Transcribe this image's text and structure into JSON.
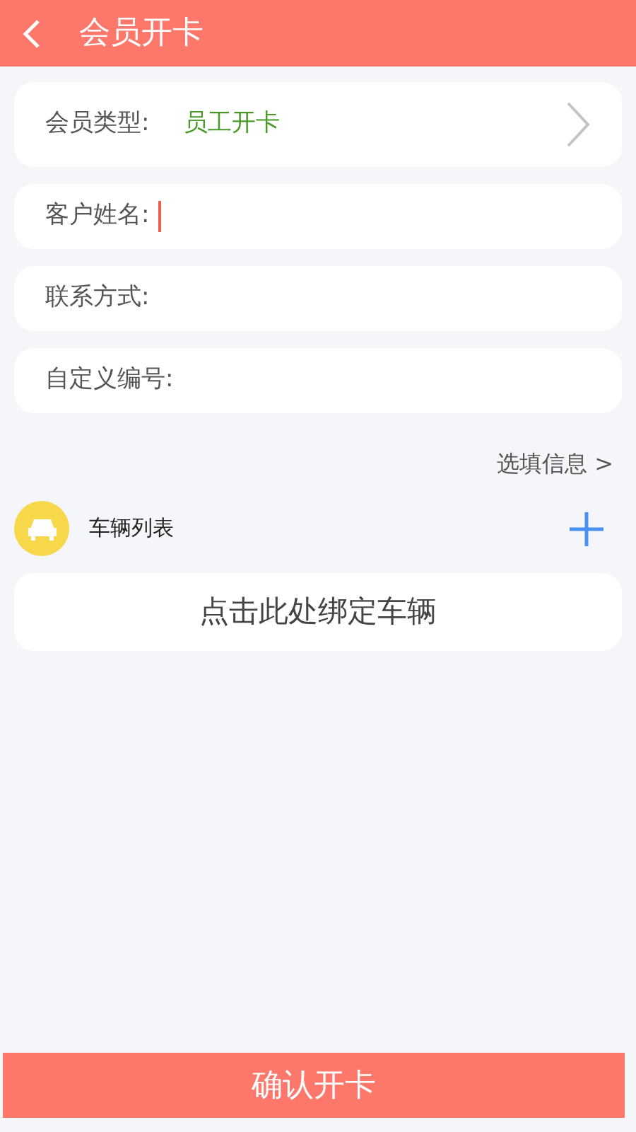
{
  "header": {
    "title": "会员开卡"
  },
  "fields": [
    {
      "kind": "select",
      "label": "会员类型:",
      "value": "员工开卡"
    },
    {
      "kind": "input",
      "label": "客户姓名:",
      "focused": true
    },
    {
      "kind": "input",
      "label": "联系方式:",
      "focused": false
    },
    {
      "kind": "input",
      "label": "自定义编号:",
      "focused": false
    }
  ],
  "optional_link": "选填信息 >",
  "vehicles": {
    "title": "车辆列表",
    "bind_prompt": "点击此处绑定车辆"
  },
  "confirm_button": "确认开卡"
}
